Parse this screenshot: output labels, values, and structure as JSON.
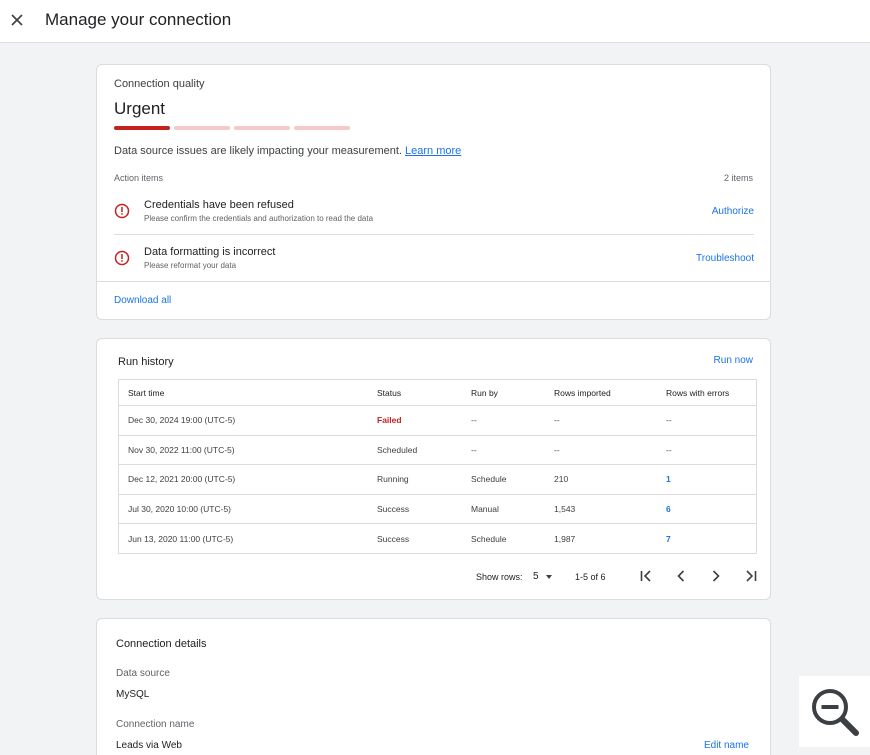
{
  "header": {
    "title": "Manage your connection",
    "close_icon": "close-icon"
  },
  "quality": {
    "label": "Connection quality",
    "level": "Urgent",
    "meter": {
      "total_segments": 4,
      "filled_segments": 1,
      "fill_color": "#c5221f",
      "empty_color": "#f6c9cc"
    },
    "description": "Data source issues are likely impacting your measurement.",
    "learn_more": "Learn more",
    "action_items_label": "Action items",
    "action_items_count": "2 items",
    "actions": [
      {
        "icon": "alert-circle-icon",
        "title": "Credentials have been refused",
        "subtitle": "Please confirm the credentials and authorization to read the data",
        "button": "Authorize"
      },
      {
        "icon": "alert-circle-icon",
        "title": "Data formatting is incorrect",
        "subtitle": "Please reformat your data",
        "button": "Troubleshoot"
      }
    ],
    "download_all": "Download all"
  },
  "history": {
    "title": "Run history",
    "run_now": "Run now",
    "columns": [
      "Start time",
      "Status",
      "Run by",
      "Rows imported",
      "Rows with errors"
    ],
    "rows": [
      {
        "start": "Dec 30, 2024  19:00 (UTC-5)",
        "status": "Failed",
        "run_by": "--",
        "imported": "--",
        "errors": "--"
      },
      {
        "start": "Nov 30, 2022  11:00 (UTC-5)",
        "status": "Scheduled",
        "run_by": "--",
        "imported": "--",
        "errors": "--"
      },
      {
        "start": "Dec 12, 2021  20:00 (UTC-5)",
        "status": "Running",
        "run_by": "Schedule",
        "imported": "210",
        "errors": "1"
      },
      {
        "start": "Jul 30, 2020  10:00 (UTC-5)",
        "status": "Success",
        "run_by": "Manual",
        "imported": "1,543",
        "errors": "6"
      },
      {
        "start": "Jun 13, 2020  11:00 (UTC-5)",
        "status": "Success",
        "run_by": "Schedule",
        "imported": "1,987",
        "errors": "7"
      }
    ],
    "pagination": {
      "show_rows_label": "Show rows:",
      "rows_value": "5",
      "range": "1-5 of 6"
    }
  },
  "details": {
    "title": "Connection details",
    "data_source_label": "Data source",
    "data_source_value": "MySQL",
    "connection_name_label": "Connection name",
    "connection_name_value": "Leads via Web",
    "edit_name": "Edit name"
  },
  "colors": {
    "accent": "#1a73e8",
    "error": "#c5221f",
    "border": "#dadce0",
    "background": "#f1f3f4"
  }
}
